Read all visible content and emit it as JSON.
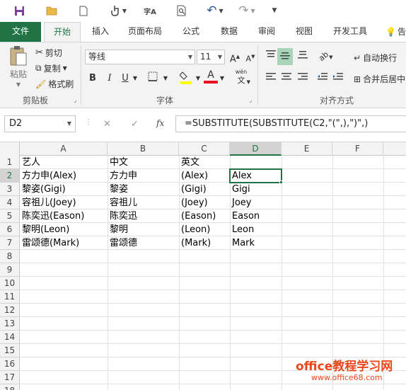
{
  "quick_access": {
    "items": [
      "save-icon",
      "open-icon",
      "new-icon",
      "touch-mode-icon",
      "spelling-icon",
      "print-preview-icon",
      "undo-icon",
      "redo-icon",
      "customize-icon"
    ]
  },
  "tabs": [
    {
      "label": "文件"
    },
    {
      "label": "开始"
    },
    {
      "label": "插入"
    },
    {
      "label": "页面布局"
    },
    {
      "label": "公式"
    },
    {
      "label": "数据"
    },
    {
      "label": "审阅"
    },
    {
      "label": "视图"
    },
    {
      "label": "开发工具"
    },
    {
      "label": "告"
    }
  ],
  "ribbon": {
    "clipboard": {
      "paste": "粘贴",
      "cut": "剪切",
      "copy": "复制",
      "format_painter": "格式刷",
      "group_label": "剪贴板"
    },
    "font": {
      "font_name": "等线",
      "font_size": "11",
      "group_label": "字体",
      "bold": "B",
      "italic": "I",
      "underline": "U",
      "grow": "A",
      "shrink": "A",
      "font_color_letter": "A",
      "wen": "wén",
      "wen_char": "文"
    },
    "alignment": {
      "wrap_text": "自动换行",
      "merge_center": "合并后居中",
      "group_label": "对齐方式"
    },
    "accent_color": "#217346"
  },
  "formula_bar": {
    "name_box": "D2",
    "cancel": "✕",
    "enter": "✓",
    "fx": "fx",
    "formula": "=SUBSTITUTE(SUBSTITUTE(C2,\"(\",),\")\",)"
  },
  "sheet": {
    "columns": [
      "A",
      "B",
      "C",
      "D",
      "E",
      "F"
    ],
    "selected_column": "D",
    "rows": [
      "1",
      "2",
      "3",
      "4",
      "5",
      "6",
      "7",
      "8",
      "9",
      "10",
      "11",
      "12",
      "13",
      "14",
      "15",
      "16",
      "17",
      "18"
    ],
    "selected_row": "2",
    "data": [
      [
        "艺人",
        "中文",
        "英文",
        ""
      ],
      [
        "方力申(Alex)",
        "方力申",
        "(Alex)",
        "Alex"
      ],
      [
        "黎姿(Gigi)",
        "黎姿",
        "(Gigi)",
        "Gigi"
      ],
      [
        "容祖儿(Joey)",
        "容祖儿",
        "(Joey)",
        "Joey"
      ],
      [
        "陈奕迅(Eason)",
        "陈奕迅",
        "(Eason)",
        "Eason"
      ],
      [
        "黎明(Leon)",
        "黎明",
        "(Leon)",
        "Leon"
      ],
      [
        "雷颂德(Mark)",
        "雷颂德",
        "(Mark)",
        "Mark"
      ]
    ]
  },
  "watermark": {
    "line1": "office教程学习网",
    "line2": "www.office68.com"
  }
}
